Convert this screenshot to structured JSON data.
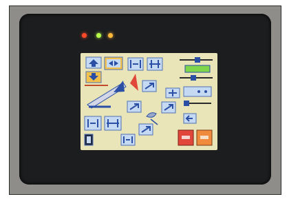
{
  "device": {
    "type": "touch-panel-hmi",
    "leds": [
      {
        "name": "status-red",
        "color": "#ff4a2a"
      },
      {
        "name": "status-green",
        "color": "#b6ff4a"
      },
      {
        "name": "status-amber",
        "color": "#ffb83a"
      }
    ]
  },
  "screen": {
    "background": "#e9e5b8",
    "accent_red": "#e0473a",
    "accent_orange": "#f08a3c",
    "button_blue": "#c6d9f2",
    "display_green": "#7fd64a",
    "icons": [
      "arrow-up-icon",
      "arrow-down-icon",
      "move-horizontal-icon",
      "gate-icon",
      "conveyor-icon",
      "cross-arrow-icon",
      "hand-cycle-icon",
      "stop-button-icon",
      "alarm-button-icon"
    ]
  }
}
